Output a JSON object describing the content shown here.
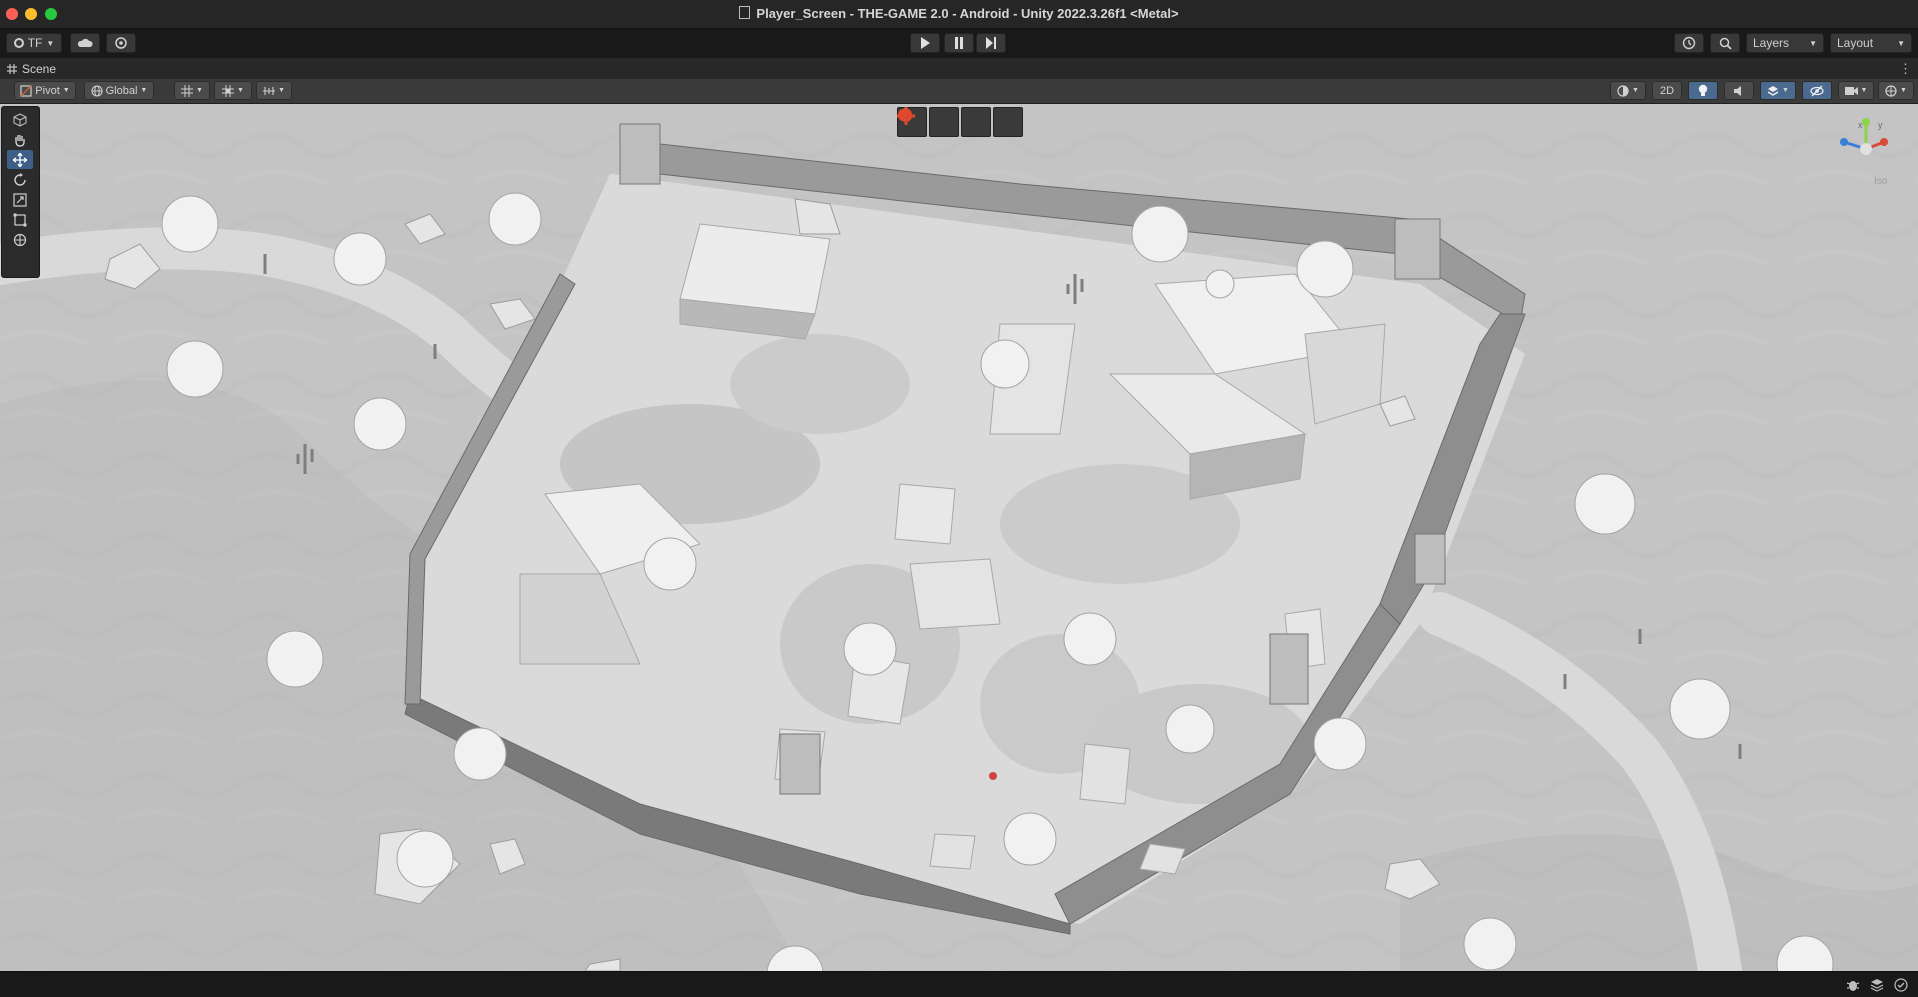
{
  "window": {
    "title": "Player_Screen - THE-GAME 2.0 - Android - Unity 2022.3.26f1 <Metal>"
  },
  "toolbar": {
    "account_label": "TF",
    "layers_label": "Layers",
    "layout_label": "Layout"
  },
  "scene_tab": {
    "label": "Scene"
  },
  "scene_toolbar": {
    "pivot_label": "Pivot",
    "global_label": "Global",
    "mode_2d_label": "2D"
  },
  "gizmo": {
    "projection_label": "Iso"
  },
  "colors": {
    "accent": "#3e5f86",
    "overlay_red": "#e0482f",
    "ground": "#c4c4c4",
    "path": "#d9d9d9"
  }
}
